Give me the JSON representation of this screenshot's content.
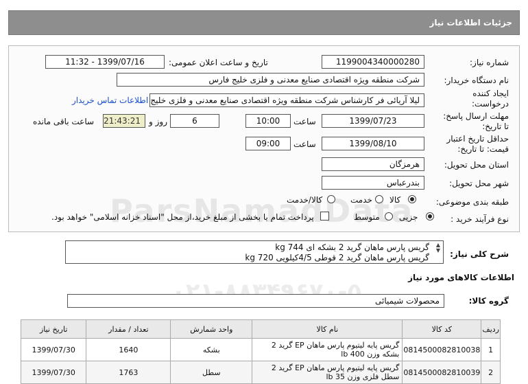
{
  "header": {
    "title": "جزئیات اطلاعات نیاز"
  },
  "form": {
    "need_number_label": "شماره نیاز:",
    "need_number": "1199004340000280",
    "announce_label": "تاریخ و ساعت اعلان عمومی:",
    "announce_value": "1399/07/16 - 11:32",
    "buyer_org_label": "نام دستگاه خریدار:",
    "buyer_org": "شرکت منطقه ویژه اقتصادی صنایع معدنی و فلزی خلیج فارس",
    "creator_label_1": "ایجاد کننده",
    "creator_label_2": "درخواست:",
    "creator": "لیلا آریائی فر کارشناس شرکت منطقه ویژه اقتصادی صنایع معدنی و فلزی خلیج فارس",
    "buyer_contact_link": "اطلاعات تماس خریدار",
    "deadline_label_1": "مهلت ارسال پاسخ:",
    "deadline_label_2": "تا تاریخ:",
    "deadline_date": "1399/07/23",
    "time_label": "ساعت",
    "deadline_time": "10:00",
    "days": "6",
    "days_label": "روز و",
    "remaining_time": "21:43:21",
    "remaining_label": "ساعت باقی مانده",
    "validity_label_1": "حداقل تاریخ اعتبار",
    "validity_label_2": "قیمت: تا تاریخ:",
    "validity_date": "1399/08/10",
    "validity_time_label": "ساعت",
    "validity_time": "09:00",
    "province_label": "استان محل تحویل:",
    "province": "هرمزگان",
    "city_label": "شهر محل تحویل:",
    "city": "بندرعباس",
    "category_label": "طبقه بندی موضوعی:",
    "category_options": [
      "کالا",
      "خدمت",
      "کالا/خدمت"
    ],
    "category_selected": "کالا",
    "purchase_label": "نوع فرآیند خرید :",
    "purchase_options": [
      "جزیی",
      "متوسط"
    ],
    "purchase_selected": "جزیی",
    "payment_note": "پرداخت تمام یا بخشی از مبلغ خرید،از محل \"اسناد خزانه اسلامی\" خواهد بود."
  },
  "description": {
    "label": "شرح کلی نیاز:",
    "lines": [
      "گریس پارس ماهان گرید 2 بشکه ای kg 744",
      "گریس پارس ماهان گرید 2 قوطی 4/5کیلویی kg 720"
    ]
  },
  "goods": {
    "section_title": "اطلاعات کالاهای مورد نیاز",
    "group_label": "گروه کالا:",
    "group_value": "محصولات شیمیائی",
    "columns": [
      "ردیف",
      "کد کالا",
      "نام کالا",
      "واحد شمارش",
      "تعداد / مقدار",
      "تاریخ نیاز"
    ],
    "rows": [
      {
        "idx": "1",
        "code": "0814500082810038",
        "name": "گریس پایه لیتیوم پارس ماهان EP گرید 2 بشکه وزن lb 400",
        "unit": "بشکه",
        "qty": "1640",
        "date": "1399/07/30"
      },
      {
        "idx": "2",
        "code": "0814500082810039",
        "name": "گریس پایه لیتیوم پارس ماهان EP گرید 2 سطل فلزی وزن 35 lb",
        "unit": "سطل",
        "qty": "1763",
        "date": "1399/07/30"
      }
    ]
  },
  "watermark": {
    "text": "ParsNamadData",
    "phone": "۰۲۱-۸۸۳۴۹۶۷۰-۵"
  }
}
